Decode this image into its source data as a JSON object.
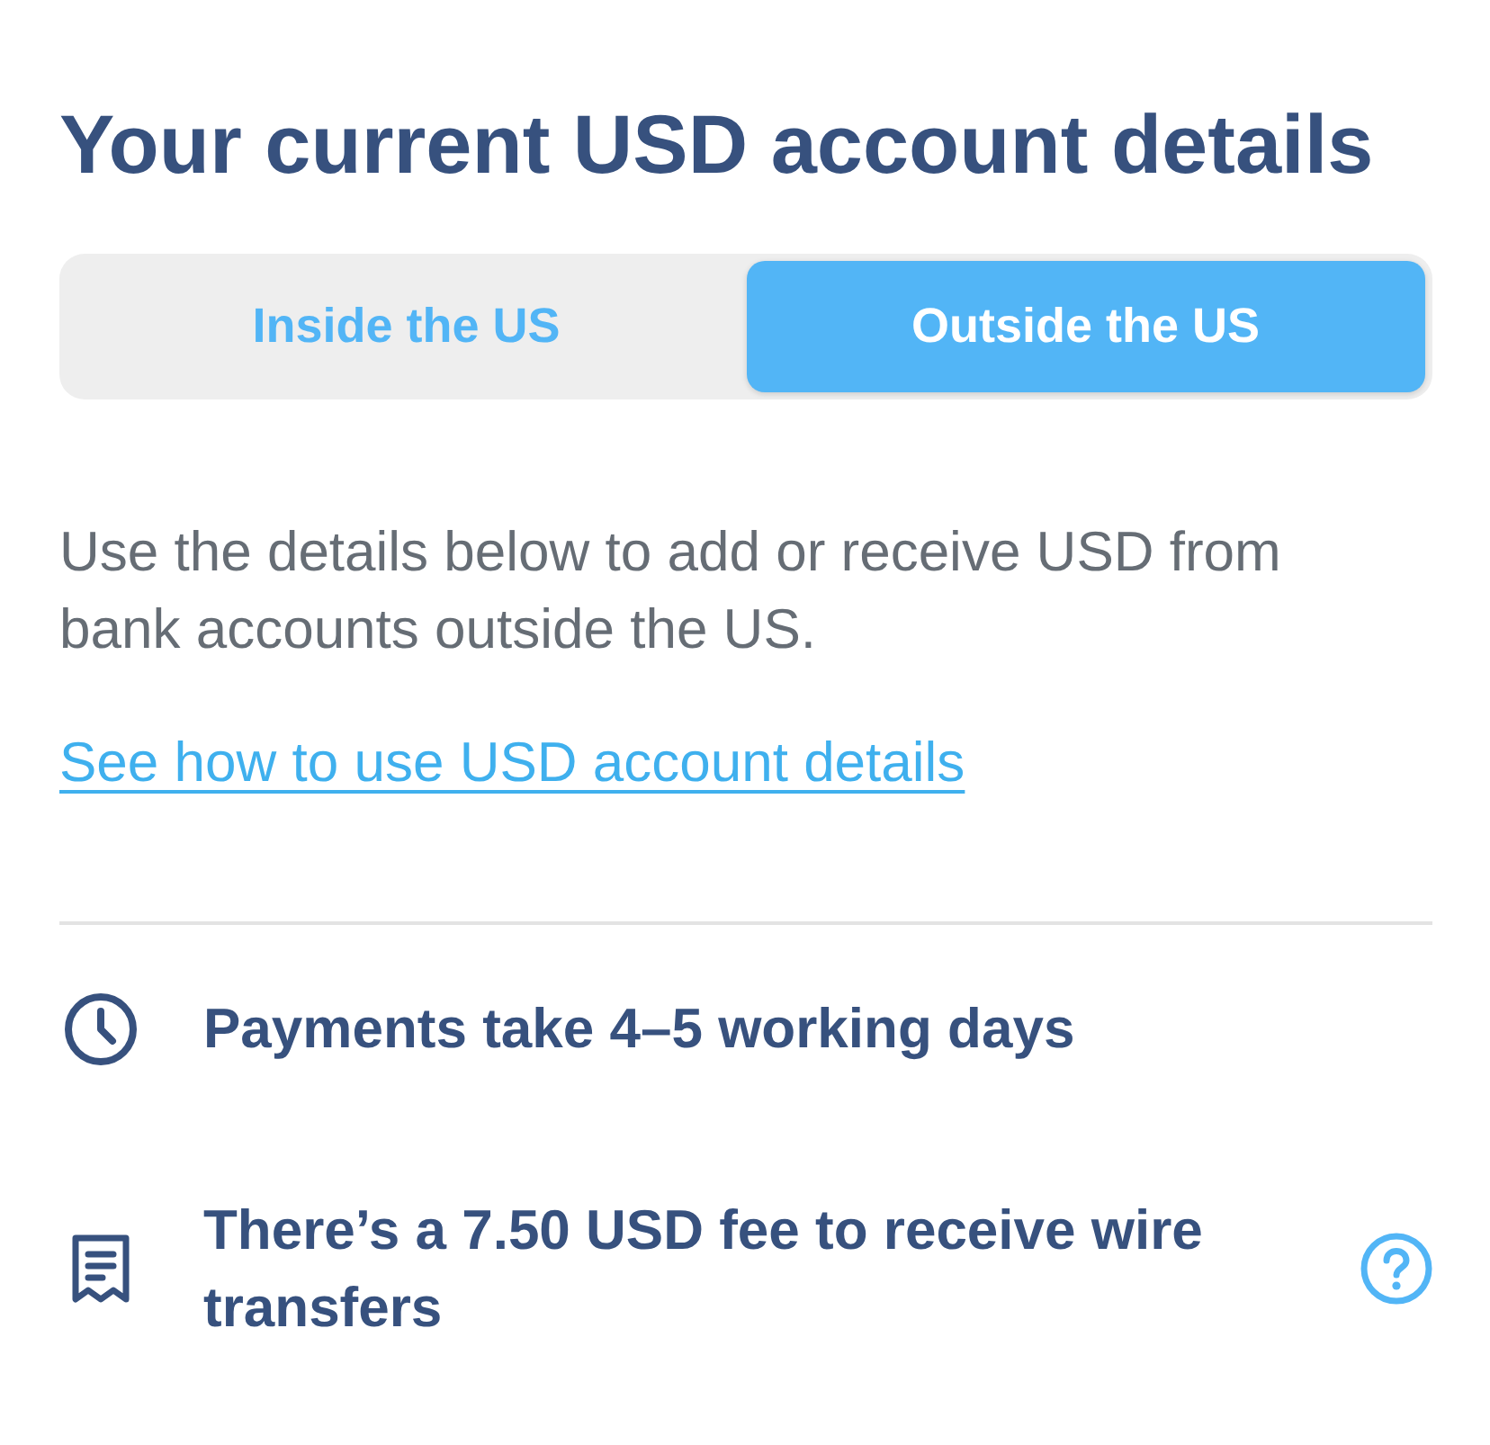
{
  "title": "Your current USD account details",
  "tabs": [
    {
      "label": "Inside the US",
      "selected": false
    },
    {
      "label": "Outside the US",
      "selected": true
    }
  ],
  "description": "Use the details below to add or receive USD from bank accounts outside the US.",
  "link": "See how to use USD account details",
  "info_items": [
    {
      "kind": "clock",
      "text": "Payments take 4–5 working days",
      "help": false
    },
    {
      "kind": "receipt",
      "text": "There’s a 7.50 USD fee to receive wire transfers",
      "help": true
    }
  ]
}
